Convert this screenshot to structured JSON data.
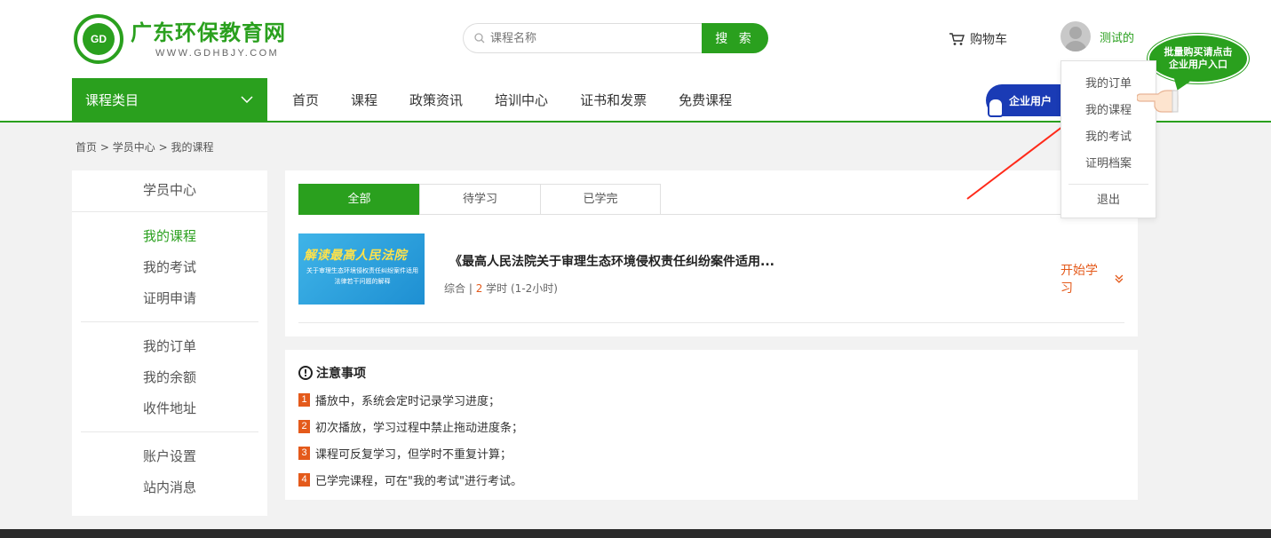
{
  "brand": {
    "title": "广东环保教育网",
    "url_text": "WWW.GDHBJY.COM",
    "logo_text": "GD"
  },
  "search": {
    "placeholder": "课程名称",
    "button_label": "搜 索"
  },
  "cart_label": "购物车",
  "user": {
    "name": "测试的"
  },
  "bubble": {
    "line1": "批量购买请点击",
    "line2": "企业用户入口"
  },
  "enterprise_button": "企业用户",
  "nav": {
    "category_label": "课程类目",
    "items": [
      "首页",
      "课程",
      "政策资讯",
      "培训中心",
      "证书和发票",
      "免费课程"
    ]
  },
  "dropdown": {
    "items": [
      "我的订单",
      "我的课程",
      "我的考试",
      "证明档案"
    ],
    "logout": "退出"
  },
  "breadcrumb": [
    "首页",
    "学员中心",
    "我的课程"
  ],
  "sidebar": {
    "title": "学员中心",
    "group1": [
      "我的课程",
      "我的考试",
      "证明申请"
    ],
    "group2": [
      "我的订单",
      "我的余额",
      "收件地址"
    ],
    "group3": [
      "账户设置",
      "站内消息"
    ]
  },
  "tabs": [
    "全部",
    "待学习",
    "已学完"
  ],
  "course": {
    "thumb_title": "解读最高人民法院",
    "thumb_sub": "关于审理生态环境侵权责任纠纷案件适用法律若干问题的解释",
    "title": "《最高人民法院关于审理生态环境侵权责任纠纷案件适用...",
    "category": "综合",
    "hours": "2",
    "hours_unit": "学时",
    "duration": "(1-2小时)",
    "start_label": "开始学习"
  },
  "notes": {
    "title": "注意事项",
    "items": [
      "播放中，系统会定时记录学习进度；",
      "初次播放，学习过程中禁止拖动进度条；",
      "课程可反复学习，但学时不重复计算；",
      "已学完课程，可在\"我的考试\"进行考试。"
    ]
  },
  "colors": {
    "brand_green": "#2aa01e",
    "accent_orange": "#e45a1b",
    "enterprise_blue": "#1a3bb5"
  }
}
